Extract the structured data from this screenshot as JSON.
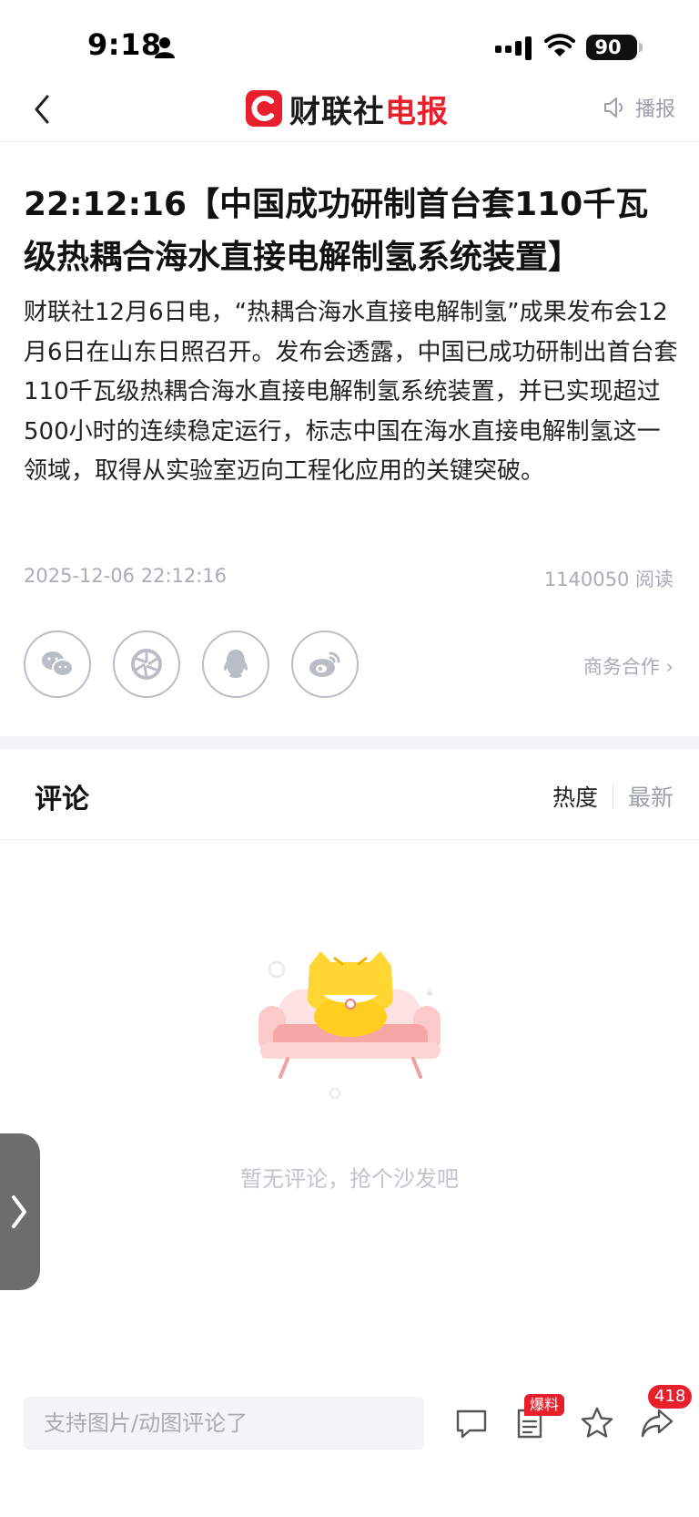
{
  "status_bar": {
    "time": "9:18",
    "battery": "90"
  },
  "nav": {
    "logo_left": "财联社",
    "logo_right": "电报",
    "broadcast_label": "播报"
  },
  "article": {
    "title": "22:12:16【中国成功研制首台套110千瓦级热耦合海水直接电解制氢系统装置】",
    "body": "财联社12月6日电，“热耦合海水直接电解制氢”成果发布会12月6日在山东日照召开。发布会透露，中国已成功研制出首台套110千瓦级热耦合海水直接电解制氢系统装置，并已实现超过500小时的连续稳定运行，标志中国在海水直接电解制氢这一领域，取得从实验室迈向工程化应用的关键突破。",
    "date": "2025-12-06 22:12:16",
    "reads": "1140050",
    "reads_label": "阅读"
  },
  "share": {
    "icons": [
      "wechat-icon",
      "moments-icon",
      "qq-icon",
      "weibo-icon"
    ],
    "business_link": "商务合作 ›"
  },
  "comments": {
    "title": "评论",
    "sort_hot": "热度",
    "sort_new": "最新",
    "empty_text": "暂无评论，抢个沙发吧"
  },
  "bottom_bar": {
    "input_placeholder": "支持图片/动图评论了",
    "burst_badge": "爆料",
    "share_count": "418"
  },
  "colors": {
    "brand_red": "#e8202c",
    "muted_gray": "#a8adb4"
  }
}
